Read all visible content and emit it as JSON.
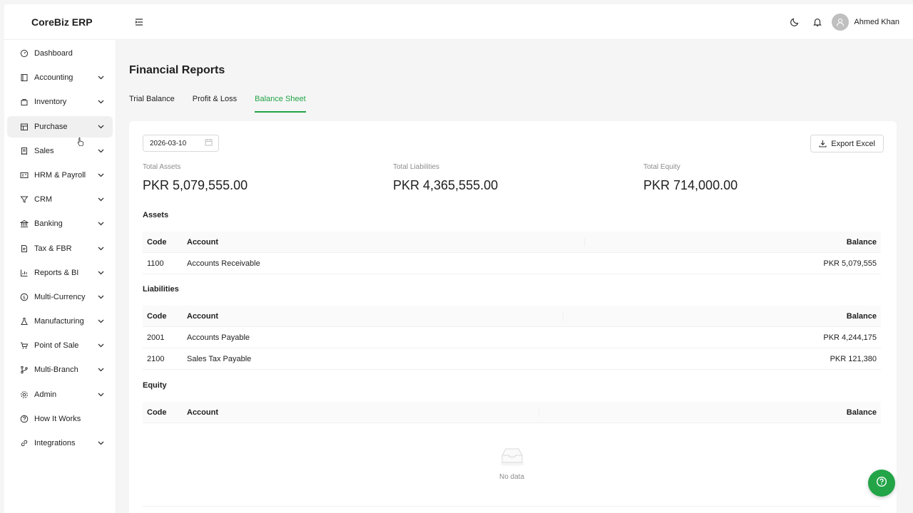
{
  "app": {
    "brand": "CoreBiz ERP"
  },
  "header": {
    "user_name": "Ahmed Khan"
  },
  "sidebar": {
    "items": [
      {
        "label": "Dashboard",
        "icon": "dashboard-icon"
      },
      {
        "label": "Accounting",
        "icon": "book-icon"
      },
      {
        "label": "Inventory",
        "icon": "box-icon"
      },
      {
        "label": "Purchase",
        "icon": "shop-icon"
      },
      {
        "label": "Sales",
        "icon": "receipt-icon"
      },
      {
        "label": "HRM & Payroll",
        "icon": "idcard-icon"
      },
      {
        "label": "CRM",
        "icon": "funnel-icon"
      },
      {
        "label": "Banking",
        "icon": "bank-icon"
      },
      {
        "label": "Tax & FBR",
        "icon": "tax-doc-icon"
      },
      {
        "label": "Reports & BI",
        "icon": "bar-chart-icon"
      },
      {
        "label": "Multi-Currency",
        "icon": "dollar-icon"
      },
      {
        "label": "Manufacturing",
        "icon": "flask-icon"
      },
      {
        "label": "Point of Sale",
        "icon": "cart-icon"
      },
      {
        "label": "Multi-Branch",
        "icon": "branch-icon"
      },
      {
        "label": "Admin",
        "icon": "gear-icon"
      },
      {
        "label": "How It Works",
        "icon": "question-icon"
      },
      {
        "label": "Integrations",
        "icon": "link-icon"
      }
    ]
  },
  "page": {
    "title": "Financial Reports",
    "tabs": [
      {
        "label": "Trial Balance"
      },
      {
        "label": "Profit & Loss"
      },
      {
        "label": "Balance Sheet"
      }
    ],
    "date": "2026-03-10",
    "export_label": "Export Excel"
  },
  "summary": {
    "assets_label": "Total Assets",
    "assets_value": "PKR 5,079,555.00",
    "liabilities_label": "Total Liabilities",
    "liabilities_value": "PKR 4,365,555.00",
    "equity_label": "Total Equity",
    "equity_value": "PKR 714,000.00"
  },
  "columns": {
    "code": "Code",
    "account": "Account",
    "balance": "Balance"
  },
  "assets": {
    "title": "Assets",
    "rows": [
      {
        "code": "1100",
        "account": "Accounts Receivable",
        "balance": "PKR 5,079,555"
      }
    ]
  },
  "liabilities": {
    "title": "Liabilities",
    "rows": [
      {
        "code": "2001",
        "account": "Accounts Payable",
        "balance": "PKR 4,244,175"
      },
      {
        "code": "2100",
        "account": "Sales Tax Payable",
        "balance": "PKR 121,380"
      }
    ]
  },
  "equity": {
    "title": "Equity",
    "empty_text": "No data"
  },
  "colors": {
    "accent": "#22a447"
  }
}
